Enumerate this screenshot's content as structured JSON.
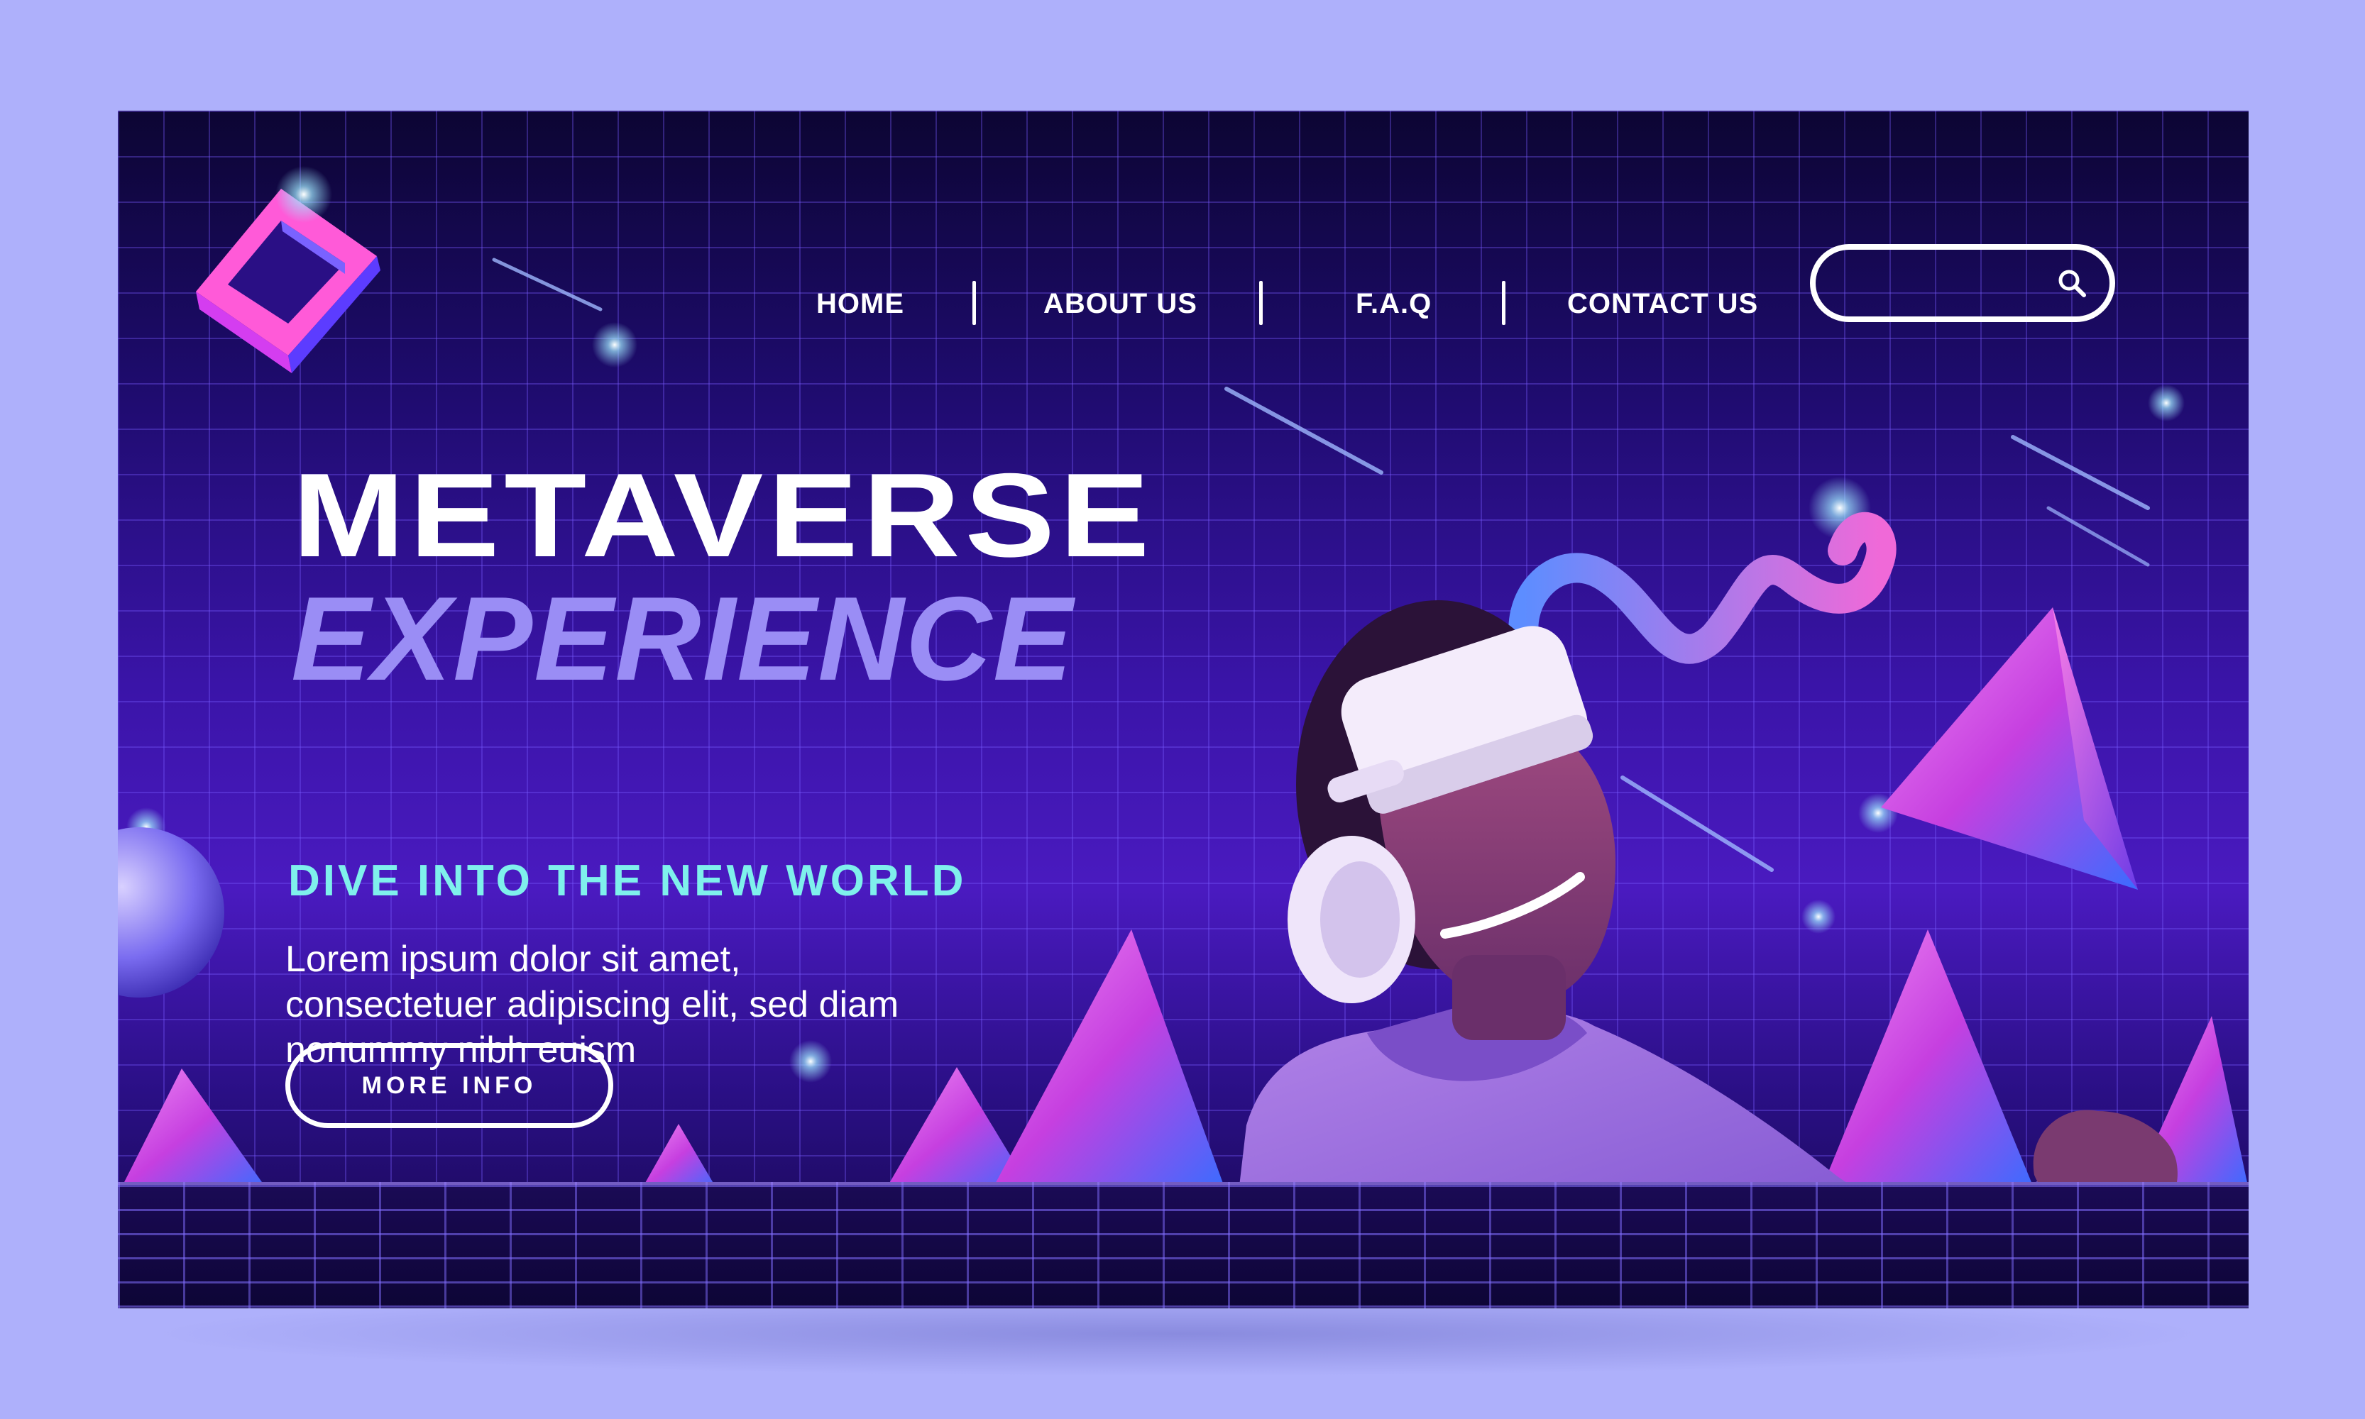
{
  "nav": {
    "items": [
      {
        "label": "HOME"
      },
      {
        "label": "ABOUT US"
      },
      {
        "label": "F.A.Q"
      },
      {
        "label": "CONTACT US"
      }
    ]
  },
  "search": {
    "placeholder": "",
    "icon": "search-icon"
  },
  "hero": {
    "title": "METAVERSE",
    "subtitle": "EXPERIENCE",
    "tagline": "DIVE INTO THE NEW WORLD",
    "body_lines": [
      "Lorem ipsum dolor sit amet,",
      "consectetuer adipiscing elit, sed diam",
      "nonummy nibh euism"
    ],
    "cta_label": "MORE INFO"
  },
  "colors": {
    "page_background": "#aeb0fb",
    "card_background_top": "#0c0533",
    "card_background_mid": "#4a1ac0",
    "subtitle": "#9a8df5",
    "tagline": "#7ff0ec",
    "accent_pink": "#e040e0",
    "accent_blue": "#4f7dff"
  },
  "decorations": {
    "logo": "isometric-square-frame-logo",
    "illustration": "person-wearing-vr-headset",
    "shapes": [
      "pyramid",
      "sphere",
      "wave-ribbon",
      "shooting-star",
      "sparkle"
    ]
  }
}
